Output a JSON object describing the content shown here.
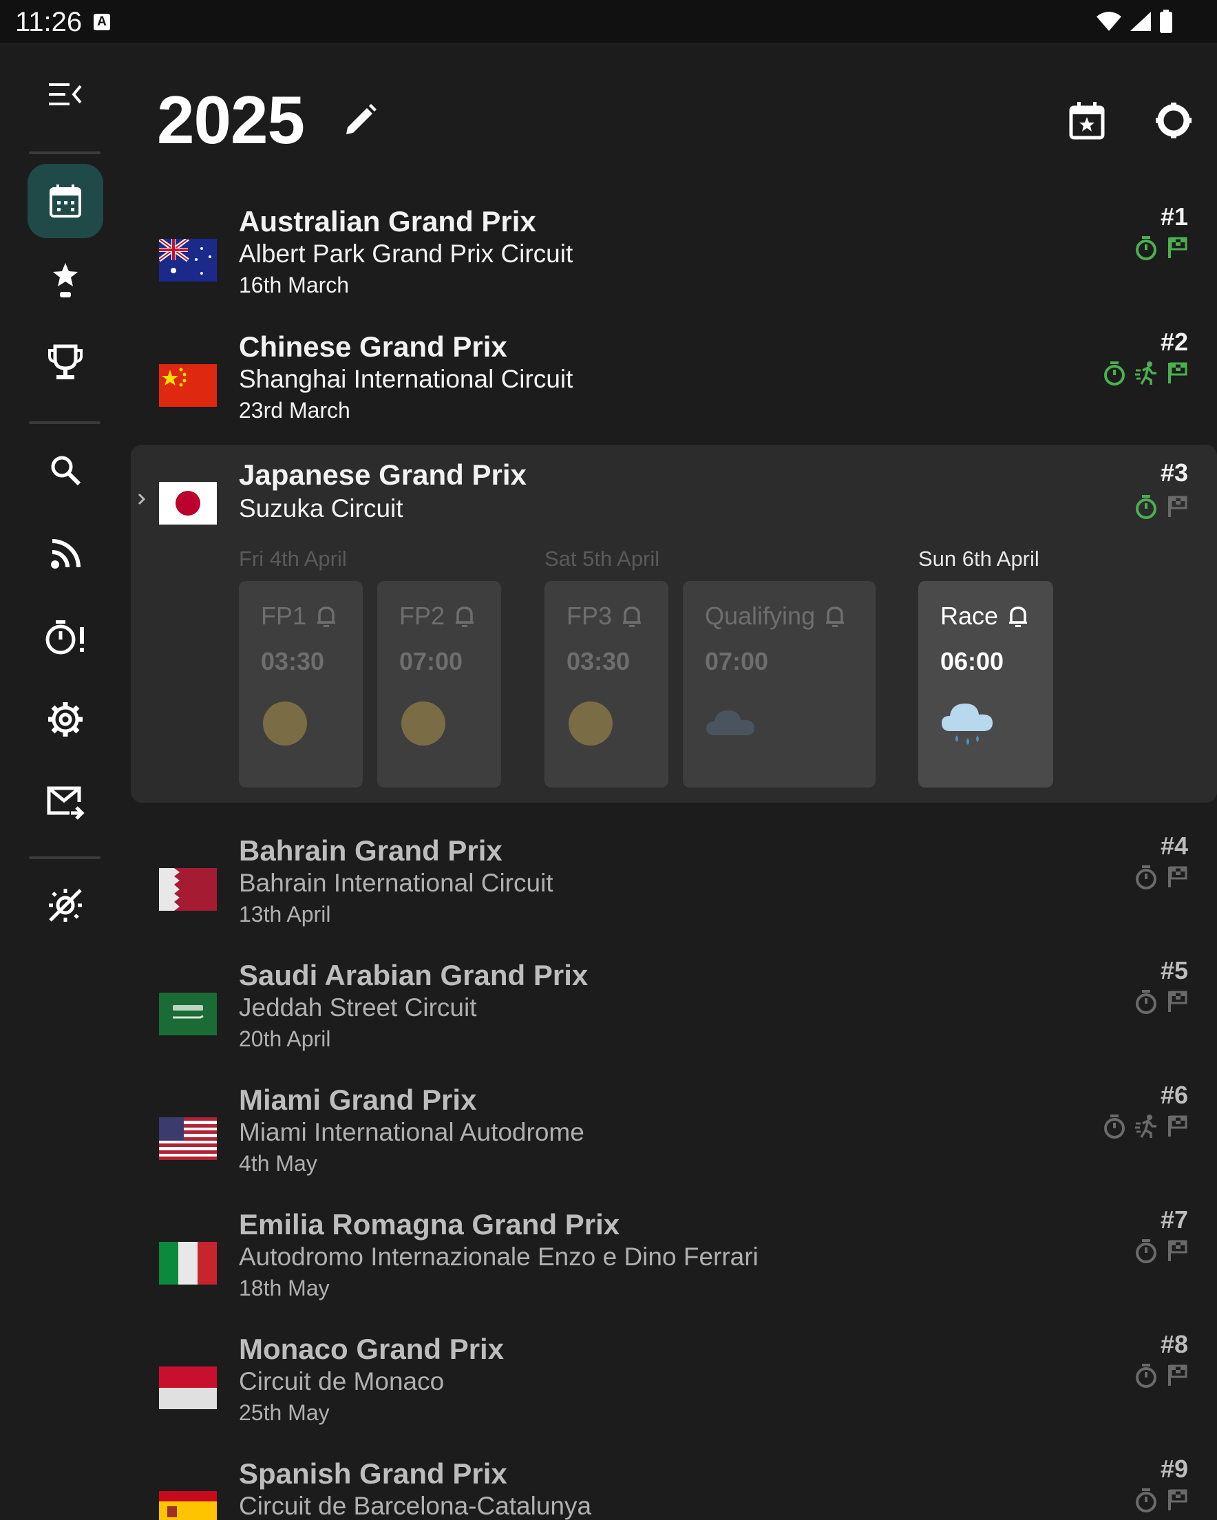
{
  "status": {
    "time": "11:26",
    "badge": "A"
  },
  "header": {
    "year": "2025"
  },
  "races": [
    {
      "name": "Australian Grand Prix",
      "circuit": "Albert Park Grand Prix Circuit",
      "date": "16th March",
      "round": "#1"
    },
    {
      "name": "Chinese Grand Prix",
      "circuit": "Shanghai International Circuit",
      "date": "23rd March",
      "round": "#2"
    },
    {
      "name": "Japanese Grand Prix",
      "circuit": "Suzuka Circuit",
      "round": "#3",
      "days": [
        "Fri 4th April",
        "Sat 5th April",
        "Sun 6th April"
      ],
      "sessions": [
        {
          "label": "FP1",
          "time": "03:30",
          "weather": "sun"
        },
        {
          "label": "FP2",
          "time": "07:00",
          "weather": "sun"
        },
        {
          "label": "FP3",
          "time": "03:30",
          "weather": "sun"
        },
        {
          "label": "Qualifying",
          "time": "07:00",
          "weather": "cloud"
        },
        {
          "label": "Race",
          "time": "06:00",
          "weather": "rain"
        }
      ]
    },
    {
      "name": "Bahrain Grand Prix",
      "circuit": "Bahrain International Circuit",
      "date": "13th April",
      "round": "#4"
    },
    {
      "name": "Saudi Arabian Grand Prix",
      "circuit": "Jeddah Street Circuit",
      "date": "20th April",
      "round": "#5"
    },
    {
      "name": "Miami Grand Prix",
      "circuit": "Miami International Autodrome",
      "date": "4th May",
      "round": "#6"
    },
    {
      "name": "Emilia Romagna Grand Prix",
      "circuit": "Autodromo Internazionale Enzo e Dino Ferrari",
      "date": "18th May",
      "round": "#7"
    },
    {
      "name": "Monaco Grand Prix",
      "circuit": "Circuit de Monaco",
      "date": "25th May",
      "round": "#8"
    },
    {
      "name": "Spanish Grand Prix",
      "circuit": "Circuit de Barcelona-Catalunya",
      "date": "",
      "round": "#9"
    }
  ],
  "colors": {
    "accent_green": "#4caf50",
    "active_nav": "#1f4a48",
    "dim_icon": "#6a6a6a"
  }
}
